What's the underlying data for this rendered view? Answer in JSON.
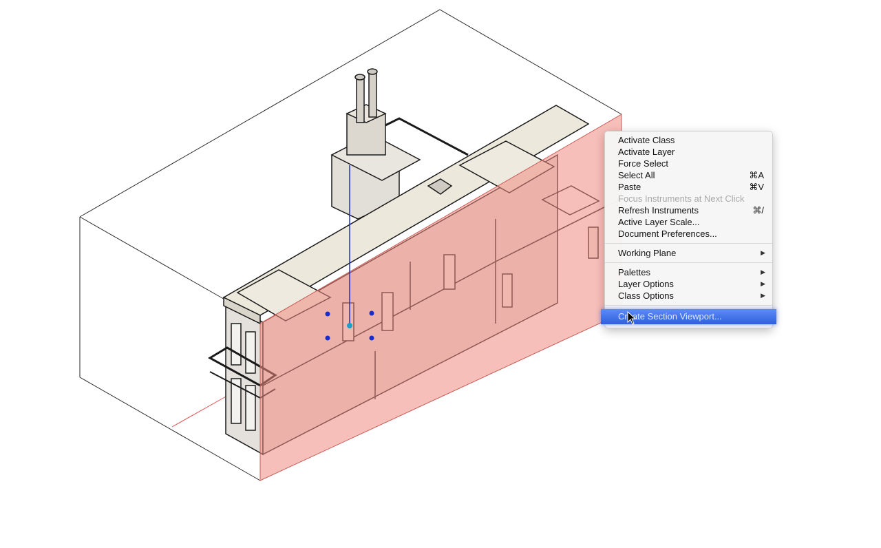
{
  "context_menu": {
    "group1": [
      {
        "label": "Activate Class",
        "shortcut": "",
        "enabled": true
      },
      {
        "label": "Activate Layer",
        "shortcut": "",
        "enabled": true
      },
      {
        "label": "Force Select",
        "shortcut": "",
        "enabled": true
      },
      {
        "label": "Select All",
        "shortcut": "⌘A",
        "enabled": true
      },
      {
        "label": "Paste",
        "shortcut": "⌘V",
        "enabled": true
      },
      {
        "label": "Focus Instruments at Next Click",
        "shortcut": "",
        "enabled": false
      },
      {
        "label": "Refresh Instruments",
        "shortcut": "⌘/",
        "enabled": true
      },
      {
        "label": "Active Layer Scale...",
        "shortcut": "",
        "enabled": true
      },
      {
        "label": "Document Preferences...",
        "shortcut": "",
        "enabled": true
      }
    ],
    "group2": [
      {
        "label": "Working Plane",
        "submenu": true
      }
    ],
    "group3": [
      {
        "label": "Palettes",
        "submenu": true
      },
      {
        "label": "Layer Options",
        "submenu": true
      },
      {
        "label": "Class Options",
        "submenu": true
      }
    ],
    "highlighted": {
      "label": "Create Section Viewport...",
      "highlight_color": "#3a6ae8"
    }
  },
  "colors": {
    "section_plane": "#f08a80",
    "roof": "#ece8dc",
    "wall": "#e6e3de",
    "selection_handle": "#1a2ccc"
  },
  "icons": {
    "submenu_arrow": "triangle-right-icon",
    "cursor": "mouse-pointer-icon"
  }
}
